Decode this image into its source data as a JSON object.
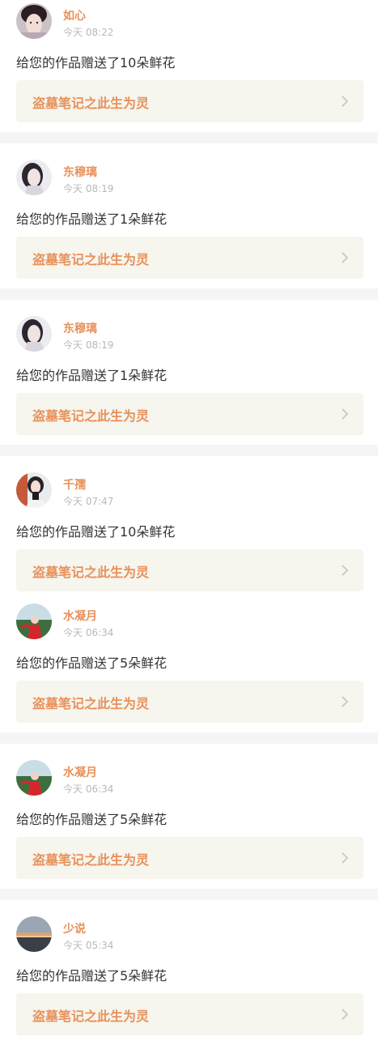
{
  "accent_color": "#e8915a",
  "items": [
    {
      "name": "如心",
      "time": "今天 08:22",
      "message": "给您的作品赠送了10朵鲜花",
      "work": "盗墓笔记之此生为灵",
      "avatar": "avatar-woman-pale-icon"
    },
    {
      "name": "东穆璃",
      "time": "今天 08:19",
      "message": "给您的作品赠送了1朵鲜花",
      "work": "盗墓笔记之此生为灵",
      "avatar": "avatar-woman-dark-hair-icon"
    },
    {
      "name": "东穆璃",
      "time": "今天 08:19",
      "message": "给您的作品赠送了1朵鲜花",
      "work": "盗墓笔记之此生为灵",
      "avatar": "avatar-woman-dark-hair-icon"
    },
    {
      "name": "千孺",
      "time": "今天 07:47",
      "message": "给您的作品赠送了10朵鲜花",
      "work": "盗墓笔记之此生为灵",
      "avatar": "avatar-girl-phone-icon"
    },
    {
      "name": "水凝月",
      "time": "今天 06:34",
      "message": "给您的作品赠送了5朵鲜花",
      "work": "盗墓笔记之此生为灵",
      "avatar": "avatar-red-dress-icon"
    },
    {
      "name": "水凝月",
      "time": "今天 06:34",
      "message": "给您的作品赠送了5朵鲜花",
      "work": "盗墓笔记之此生为灵",
      "avatar": "avatar-red-dress-icon"
    },
    {
      "name": "少说",
      "time": "今天 05:34",
      "message": "给您的作品赠送了5朵鲜花",
      "work": "盗墓笔记之此生为灵",
      "avatar": "avatar-sunset-icon"
    }
  ]
}
